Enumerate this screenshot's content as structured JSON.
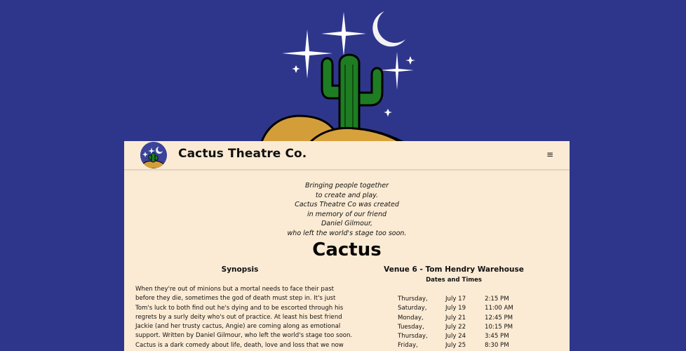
{
  "header": {
    "brand": "Cactus Theatre Co.",
    "menu_icon": "hamburger-menu-icon"
  },
  "tagline": [
    "Bringing people together",
    "to create and play.",
    "Cactus Theatre Co was created",
    "in memory of our friend",
    "Daniel Gilmour,",
    "who left the world's stage too soon."
  ],
  "show": {
    "title": "Cactus",
    "synopsis_heading": "Synopsis",
    "synopsis_lines": [
      "When they're out of minions but a mortal needs to face their past",
      "before they die, sometimes the god of death must step in. It's just",
      "Tom's luck to both find out he's dying and to be escorted through his",
      "regrets by a surly deity who's out of practice. At least his best friend",
      "Jackie (and her trusty cactus, Angie) are coming along as emotional",
      "support. Written by Daniel Gilmour, who left the world's stage too soon.",
      "Cactus is a dark comedy about life, death, love and loss that we now"
    ],
    "venue": "Venue 6 - Tom Hendry Warehouse",
    "dates_heading": "Dates and Times",
    "performances": [
      {
        "day": "Thursday,",
        "date": "July 17",
        "time": "2:15 PM"
      },
      {
        "day": "Saturday,",
        "date": "July 19",
        "time": "11:00 AM"
      },
      {
        "day": "Monday,",
        "date": "July 21",
        "time": "12:45 PM"
      },
      {
        "day": "Tuesday,",
        "date": "July 22",
        "time": "10:15 PM"
      },
      {
        "day": "Thursday,",
        "date": "July 24",
        "time": "3:45 PM"
      },
      {
        "day": "Friday,",
        "date": "July 25",
        "time": "8:30 PM"
      }
    ]
  },
  "colors": {
    "background": "#2e368c",
    "panel": "#fcebd4",
    "cactus": "#1f7a1f",
    "sand": "#d4a03a",
    "moon": "#f5f5f5"
  }
}
